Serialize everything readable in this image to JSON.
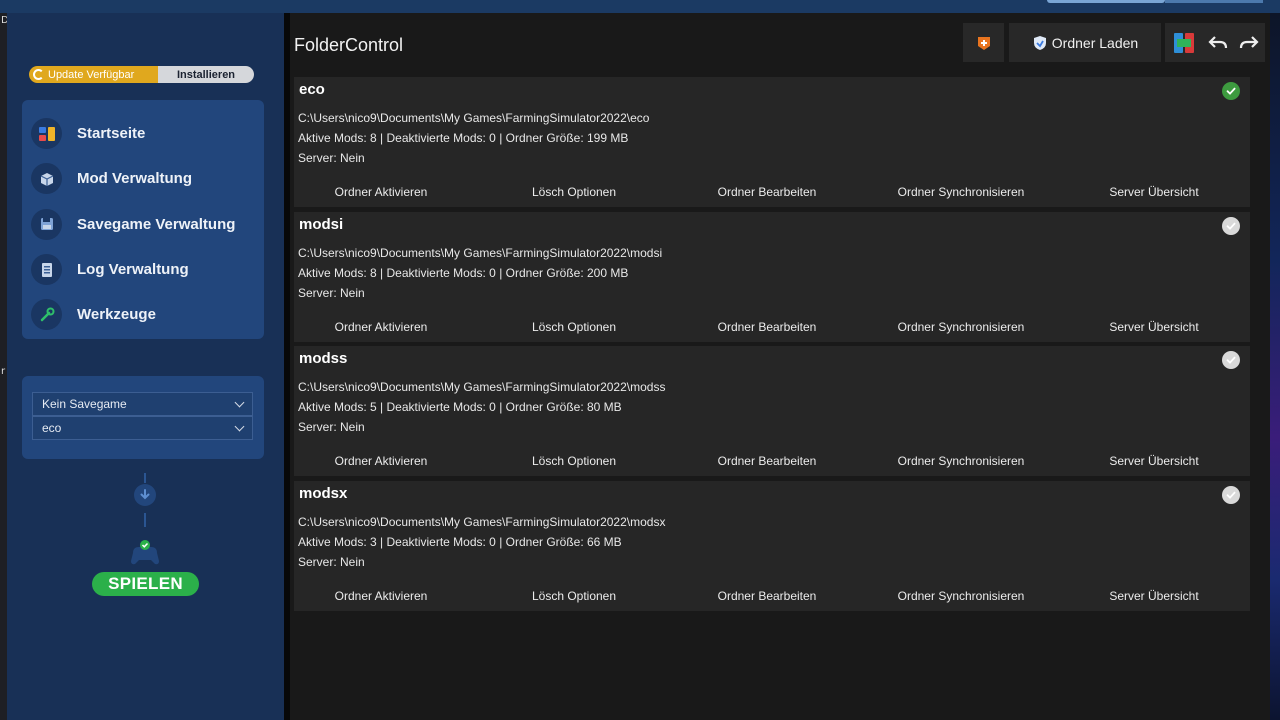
{
  "sidebar": {
    "update": {
      "label": "Update Verfügbar",
      "install_label": "Installieren"
    },
    "nav": [
      {
        "label": "Startseite",
        "icon": "dashboard-icon"
      },
      {
        "label": "Mod Verwaltung",
        "icon": "box-icon"
      },
      {
        "label": "Savegame Verwaltung",
        "icon": "save-icon"
      },
      {
        "label": "Log Verwaltung",
        "icon": "log-icon"
      },
      {
        "label": "Werkzeuge",
        "icon": "tools-icon"
      }
    ],
    "savegame_select": "Kein Savegame",
    "folder_select": "eco",
    "play_label": "SPIELEN"
  },
  "toolbar": {
    "load_folder_label": "Ordner Laden"
  },
  "page": {
    "title": "FolderControl"
  },
  "folder_actions": [
    "Ordner Aktivieren",
    "Lösch Optionen",
    "Ordner Bearbeiten",
    "Ordner Synchronisieren",
    "Server Übersicht"
  ],
  "folders": [
    {
      "name": "eco",
      "path": "C:\\Users\\nico9\\Documents\\My Games\\FarmingSimulator2022\\eco",
      "stats": "Aktive Mods: 8 | Deaktivierte Mods: 0 | Ordner Größe: 199 MB",
      "server": "Server: Nein",
      "active": true
    },
    {
      "name": "modsi",
      "path": "C:\\Users\\nico9\\Documents\\My Games\\FarmingSimulator2022\\modsi",
      "stats": "Aktive Mods: 8 | Deaktivierte Mods: 0 | Ordner Größe: 200 MB",
      "server": "Server: Nein",
      "active": false
    },
    {
      "name": "modss",
      "path": "C:\\Users\\nico9\\Documents\\My Games\\FarmingSimulator2022\\modss",
      "stats": "Aktive Mods: 5 | Deaktivierte Mods: 0 | Ordner Größe: 80 MB",
      "server": "Server: Nein",
      "active": false
    },
    {
      "name": "modsx",
      "path": "C:\\Users\\nico9\\Documents\\My Games\\FarmingSimulator2022\\modsx",
      "stats": "Aktive Mods: 3 | Deaktivierte Mods: 0 | Ordner Größe: 66 MB",
      "server": "Server: Nein",
      "active": false
    }
  ],
  "colors": {
    "sidebar": "#183056",
    "panel": "#22467c",
    "card": "#262626",
    "active": "#3d9b3f",
    "update": "#e0a81e",
    "play": "#2bb04a"
  }
}
